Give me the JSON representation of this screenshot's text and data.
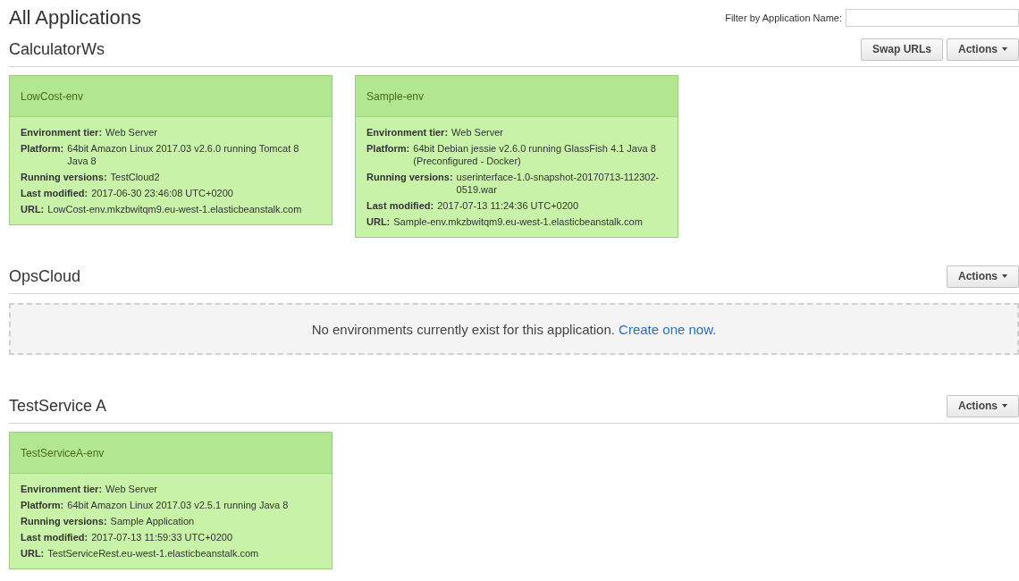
{
  "page_title": "All Applications",
  "filter": {
    "label": "Filter by Application Name:"
  },
  "applications": [
    {
      "name": "CalculatorWs",
      "buttons": [
        {
          "kind": "plain",
          "label": "Swap URLs"
        },
        {
          "kind": "dropdown",
          "label": "Actions"
        }
      ],
      "environments": [
        {
          "name": "LowCost-env",
          "fields": [
            {
              "label": "Environment tier:",
              "value": "Web Server"
            },
            {
              "label": "Platform:",
              "value": "64bit Amazon Linux 2017.03 v2.6.0 running Tomcat 8 Java 8"
            },
            {
              "label": "Running versions:",
              "value": "TestCloud2"
            },
            {
              "label": "Last modified:",
              "value": "2017-06-30 23:46:08 UTC+0200"
            },
            {
              "label": "URL:",
              "value": "LowCost-env.mkzbwitqm9.eu-west-1.elasticbeanstalk.com"
            }
          ]
        },
        {
          "name": "Sample-env",
          "fields": [
            {
              "label": "Environment tier:",
              "value": "Web Server"
            },
            {
              "label": "Platform:",
              "value": "64bit Debian jessie v2.6.0 running GlassFish 4.1 Java 8 (Preconfigured - Docker)"
            },
            {
              "label": "Running versions:",
              "value": "userinterface-1.0-snapshot-20170713-112302-0519.war"
            },
            {
              "label": "Last modified:",
              "value": "2017-07-13 11:24:36 UTC+0200"
            },
            {
              "label": "URL:",
              "value": "Sample-env.mkzbwitqm9.eu-west-1.elasticbeanstalk.com"
            }
          ]
        }
      ]
    },
    {
      "name": "OpsCloud",
      "buttons": [
        {
          "kind": "dropdown",
          "label": "Actions"
        }
      ],
      "empty": {
        "message": "No environments currently exist for this application.",
        "link": "Create one now."
      }
    },
    {
      "name": "TestService A",
      "buttons": [
        {
          "kind": "dropdown",
          "label": "Actions"
        }
      ],
      "environments": [
        {
          "name": "TestServiceA-env",
          "fields": [
            {
              "label": "Environment tier:",
              "value": "Web Server"
            },
            {
              "label": "Platform:",
              "value": "64bit Amazon Linux 2017.03 v2.5.1 running Java 8"
            },
            {
              "label": "Running versions:",
              "value": "Sample Application"
            },
            {
              "label": "Last modified:",
              "value": "2017-07-13 11:59:33 UTC+0200"
            },
            {
              "label": "URL:",
              "value": "TestServiceRest.eu-west-1.elasticbeanstalk.com"
            }
          ]
        }
      ]
    }
  ]
}
